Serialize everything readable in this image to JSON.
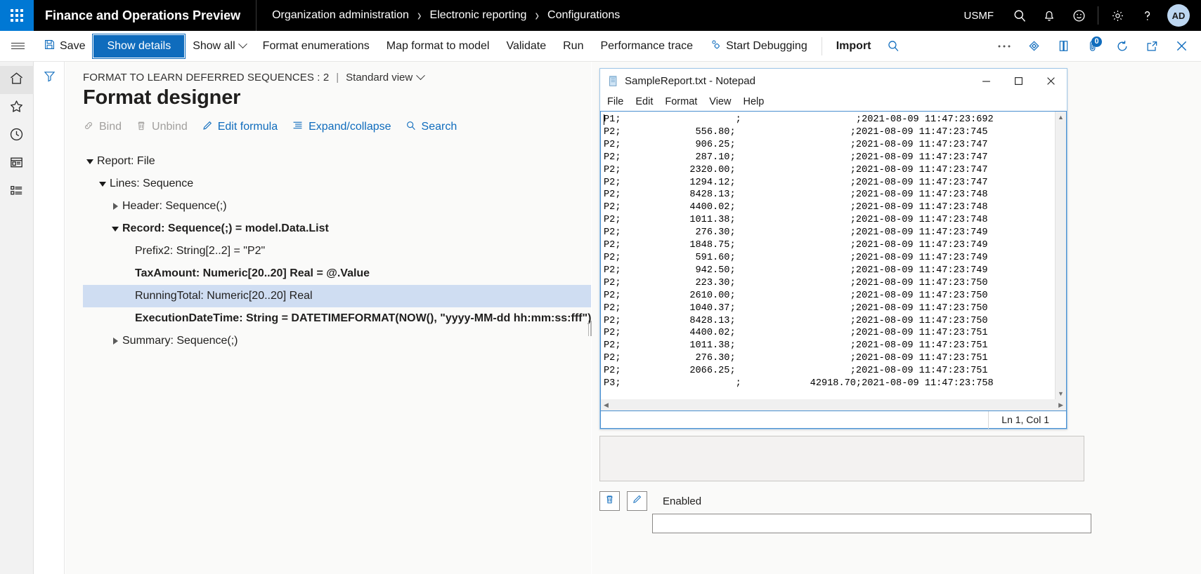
{
  "topbar": {
    "waffle_icon": "app-launcher-icon",
    "app_title": "Finance and Operations Preview",
    "breadcrumb": [
      "Organization administration",
      "Electronic reporting",
      "Configurations"
    ],
    "breadcrumb_separator": "›",
    "company_code": "USMF",
    "icons": [
      "search-icon",
      "notifications-bell-icon",
      "feedback-smiley-icon",
      "settings-gear-icon",
      "help-question-icon"
    ],
    "avatar_initials": "AD"
  },
  "actionpane": {
    "hamburger_icon": "navigation-menu-icon",
    "save_label": "Save",
    "save_icon": "save-disk-icon",
    "show_details_label": "Show details",
    "show_all_label": "Show all",
    "show_all_chevron": "chevron-down-icon",
    "format_enumerations_label": "Format enumerations",
    "map_format_to_model_label": "Map format to model",
    "validate_label": "Validate",
    "run_label": "Run",
    "performance_trace_label": "Performance trace",
    "start_debugging_label": "Start Debugging",
    "start_debugging_icon": "debug-gears-icon",
    "import_label": "Import",
    "search_icon": "search-icon",
    "overflow_icon": "more-ellipsis-icon",
    "share_icon": "share-diamond-icon",
    "office_icon": "open-in-office-icon",
    "attachments_icon": "attachments-paperclip-icon",
    "attachments_count": "0",
    "refresh_icon": "refresh-circle-icon",
    "popout_icon": "open-new-window-icon",
    "close_icon": "close-x-icon"
  },
  "leftrail": {
    "items": [
      {
        "name": "home",
        "icon": "home-icon",
        "active": true
      },
      {
        "name": "favorites",
        "icon": "star-icon",
        "active": false
      },
      {
        "name": "recent",
        "icon": "clock-icon",
        "active": false
      },
      {
        "name": "workspaces",
        "icon": "workspaces-window-icon",
        "active": false
      },
      {
        "name": "modules",
        "icon": "modules-list-icon",
        "active": false
      }
    ]
  },
  "filter": {
    "icon": "filter-funnel-icon"
  },
  "main": {
    "caption": "FORMAT TO LEARN DEFERRED SEQUENCES : 2",
    "caption_pipe": "|",
    "view_name": "Standard view",
    "view_chevron": "chevron-down-icon",
    "page_title": "Format designer",
    "subtoolbar": [
      {
        "label": "Bind",
        "icon": "link-bind-icon",
        "disabled": true
      },
      {
        "label": "Unbind",
        "icon": "trash-unbind-icon",
        "disabled": true
      },
      {
        "label": "Edit formula",
        "icon": "pencil-edit-icon",
        "disabled": false
      },
      {
        "label": "Expand/collapse",
        "icon": "list-expand-icon",
        "disabled": false
      },
      {
        "label": "Search",
        "icon": "search-icon",
        "disabled": false
      }
    ],
    "tree": [
      {
        "label": "Report: File",
        "indent": 0,
        "twisty": "down",
        "bold": false,
        "selected": false
      },
      {
        "label": "Lines: Sequence",
        "indent": 1,
        "twisty": "down",
        "bold": false,
        "selected": false
      },
      {
        "label": "Header: Sequence(;)",
        "indent": 2,
        "twisty": "right",
        "bold": false,
        "selected": false
      },
      {
        "label": "Record: Sequence(;) = model.Data.List",
        "indent": 2,
        "twisty": "down",
        "bold": true,
        "selected": false
      },
      {
        "label": "Prefix2: String[2..2] = \"P2\"",
        "indent": 3,
        "twisty": "none",
        "bold": false,
        "selected": false
      },
      {
        "label": "TaxAmount: Numeric[20..20] Real = @.Value",
        "indent": 3,
        "twisty": "none",
        "bold": true,
        "selected": false
      },
      {
        "label": "RunningTotal: Numeric[20..20] Real",
        "indent": 3,
        "twisty": "none",
        "bold": false,
        "selected": true
      },
      {
        "label": "ExecutionDateTime: String = DATETIMEFORMAT(NOW(), \"yyyy-MM-dd hh:mm:ss:fff\")",
        "indent": 3,
        "twisty": "none",
        "bold": true,
        "selected": false
      },
      {
        "label": "Summary: Sequence(;)",
        "indent": 2,
        "twisty": "right",
        "bold": false,
        "selected": false
      }
    ]
  },
  "notepad": {
    "icon": "notepad-document-icon",
    "title": "SampleReport.txt - Notepad",
    "minimize_icon": "minimize-icon",
    "maximize_icon": "maximize-icon",
    "close_icon": "close-x-icon",
    "menu": [
      "File",
      "Edit",
      "Format",
      "View",
      "Help"
    ],
    "scroll_up_icon": "scroll-up-arrow-icon",
    "scroll_down_icon": "scroll-down-arrow-icon",
    "scroll_left_icon": "scroll-left-arrow-icon",
    "scroll_right_icon": "scroll-right-arrow-icon",
    "status_text": "Ln 1, Col 1",
    "content": "P1;                    ;                    ;2021-08-09 11:47:23:692\nP2;             556.80;                    ;2021-08-09 11:47:23:745\nP2;             906.25;                    ;2021-08-09 11:47:23:747\nP2;             287.10;                    ;2021-08-09 11:47:23:747\nP2;            2320.00;                    ;2021-08-09 11:47:23:747\nP2;            1294.12;                    ;2021-08-09 11:47:23:747\nP2;            8428.13;                    ;2021-08-09 11:47:23:748\nP2;            4400.02;                    ;2021-08-09 11:47:23:748\nP2;            1011.38;                    ;2021-08-09 11:47:23:748\nP2;             276.30;                    ;2021-08-09 11:47:23:749\nP2;            1848.75;                    ;2021-08-09 11:47:23:749\nP2;             591.60;                    ;2021-08-09 11:47:23:749\nP2;             942.50;                    ;2021-08-09 11:47:23:749\nP2;             223.30;                    ;2021-08-09 11:47:23:750\nP2;            2610.00;                    ;2021-08-09 11:47:23:750\nP2;            1040.37;                    ;2021-08-09 11:47:23:750\nP2;            8428.13;                    ;2021-08-09 11:47:23:750\nP2;            4400.02;                    ;2021-08-09 11:47:23:751\nP2;            1011.38;                    ;2021-08-09 11:47:23:751\nP2;             276.30;                    ;2021-08-09 11:47:23:751\nP2;            2066.25;                    ;2021-08-09 11:47:23:751\nP3;                    ;            42918.70;2021-08-09 11:47:23:758"
  },
  "footer": {
    "delete_icon": "trash-delete-icon",
    "edit_icon": "pencil-edit-icon",
    "enabled_label": "Enabled"
  }
}
